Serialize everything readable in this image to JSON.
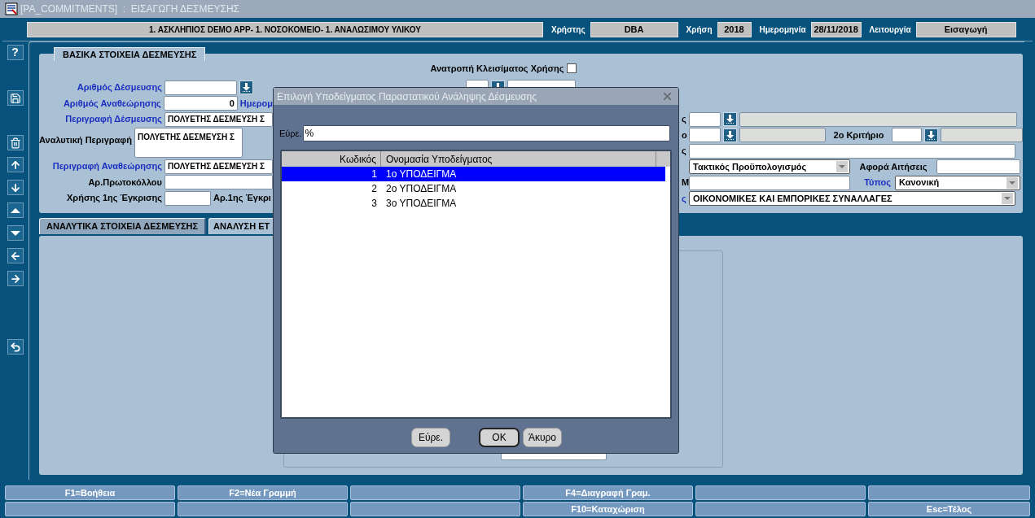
{
  "window": {
    "title": "[PA_COMMITMENTS]  :  ΕΙΣΑΓΩΓΗ ΔΕΣΜΕΥΣΗΣ"
  },
  "header": {
    "organization": "1. ΑΣΚΛΗΠΙΟΣ DEMO APP- 1. ΝΟΣΟΚΟΜΕΙΟ- 1. ΑΝΑΛΩΣΙΜΟΥ ΥΛΙΚΟΥ",
    "fields": [
      {
        "label": "Χρήστης",
        "value": "DBA"
      },
      {
        "label": "Χρήση",
        "value": "2018"
      },
      {
        "label": "Ημερομηνία",
        "value": "28/11/2018"
      },
      {
        "label": "Λειτουργία",
        "value": "Εισαγωγή"
      }
    ]
  },
  "help_button": {
    "label": "?"
  },
  "main_tab": {
    "label": "ΒΑΣΙΚΑ ΣΤΟΙΧΕΙΑ ΔΕΣΜΕΥΣΗΣ"
  },
  "closing_reversal": {
    "label": "Ανατροπή Κλεισίματος Χρήσης",
    "checked": false
  },
  "left_fields": [
    {
      "kind": "lookup",
      "label": "Αριθμός Δέσμευσης",
      "required": true
    },
    {
      "kind": "number",
      "label": "Αριθμός Αναθεώρησης",
      "required": true,
      "value": "0",
      "next_label": "Ημερομ"
    },
    {
      "kind": "text",
      "label": "Περιγραφή Δέσμευσης",
      "required": true,
      "value": "ΠΟΛΥΕΤΗΣ ΔΕΣΜΕΥΣΗ Σ"
    },
    {
      "kind": "textarea",
      "label": "Αναλυτική Περιγραφή",
      "required": false,
      "value": "ΠΟΛΥΕΤΗΣ ΔΕΣΜΕΥΣΗ Σ"
    },
    {
      "kind": "text",
      "label": "Περιγραφή Αναθεώρησης",
      "required": true,
      "value": "ΠΟΛΥΕΤΗΣ ΔΕΣΜΕΥΣΗ Σ"
    },
    {
      "kind": "text",
      "label": "Αρ.Πρωτοκόλλου",
      "required": false
    },
    {
      "kind": "short",
      "label": "Χρήσης 1ης Έγκρισης",
      "required": false,
      "next_label": "Αρ.1ης Έγκρι"
    }
  ],
  "right_rows": [
    {
      "kind": "lookup",
      "label_tail": "ς",
      "required": false
    },
    {
      "kind": "double_lookup",
      "label_tail": "ο",
      "required": false,
      "second_label": "2ο Κριτήριο"
    },
    {
      "kind": "text",
      "label_tail": "ς",
      "required": false
    },
    {
      "kind": "select_text",
      "value": "Τακτικός Προϋπολογισμός",
      "second_label": "Αφορά Αιτήσεις"
    },
    {
      "kind": "text_select",
      "label_tail": "Μ",
      "required": false,
      "second_label": "Τύπος",
      "second_required": true,
      "second_value": "Κανονική"
    },
    {
      "kind": "select",
      "label_tail": "ς",
      "required": true,
      "value": "ΟΙΚΟΝΟΜΙΚΕΣ ΚΑΙ ΕΜΠΟΡΙΚΕΣ ΣΥΝΑΛΛΑΓΕΣ"
    }
  ],
  "lower_tabs": [
    {
      "label": "ΑΝΑΛΥΤΙΚΑ ΣΤΟΙΧΕΙΑ ΔΕΣΜΕΥΣΗΣ",
      "selected": false
    },
    {
      "label": "ΑΝΑΛΥΣΗ ΕΤ",
      "selected": true
    }
  ],
  "dialog": {
    "title": "Επιλογή Υποδείγματος Παραστατικού Ανάληψης Δέσμευσης",
    "find_label": "Εύρε.",
    "find_value": "%",
    "columns": [
      "Κωδικός",
      "Ονομασία Υποδείγματος"
    ],
    "rows": [
      {
        "code": "1",
        "name": "1ο ΥΠΟΔΕΙΓΜΑ",
        "selected": true
      },
      {
        "code": "2",
        "name": "2ο ΥΠΟΔΕΙΓΜΑ",
        "selected": false
      },
      {
        "code": "3",
        "name": "3ο ΥΠΟΔΕΙΓΜΑ",
        "selected": false
      }
    ],
    "buttons": [
      {
        "label": "Εύρε.",
        "default": false
      },
      {
        "label": "OK",
        "default": true
      },
      {
        "label": "Άκυρο",
        "default": false
      }
    ]
  },
  "function_keys": [
    [
      {
        "kind": "key",
        "label": "F1=Βοήθεια"
      },
      {
        "kind": "key",
        "label": "F2=Νέα Γραμμή"
      },
      {
        "kind": "blank"
      },
      {
        "kind": "key",
        "label": "F4=Διαγραφή Γραμ."
      },
      {
        "kind": "blank"
      },
      {
        "kind": "blank"
      }
    ],
    [
      {
        "kind": "blank"
      },
      {
        "kind": "blank"
      },
      {
        "kind": "blank"
      },
      {
        "kind": "key",
        "label": "F10=Καταχώριση"
      },
      {
        "kind": "blank"
      },
      {
        "kind": "key",
        "label": "Esc=Τέλος"
      }
    ]
  ]
}
